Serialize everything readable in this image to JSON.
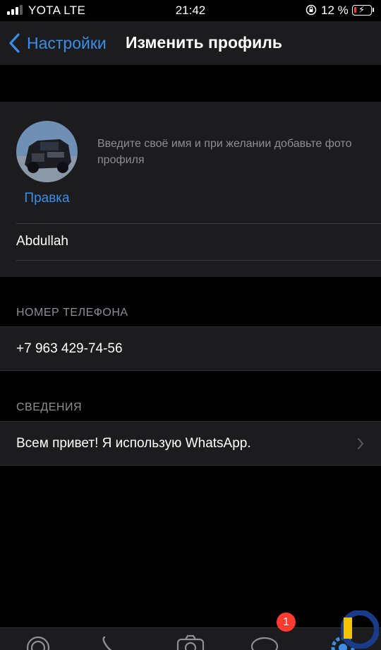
{
  "status_bar": {
    "carrier": "YOTA LTE",
    "time": "21:42",
    "battery_percent": "12 %",
    "battery_color": "#ff3b30"
  },
  "nav": {
    "back_label": "Настройки",
    "title": "Изменить профиль"
  },
  "profile": {
    "edit_photo_label": "Правка",
    "hint": "Введите своё имя и при желании добавьте фото профиля",
    "name": "Abdullah"
  },
  "phone_section": {
    "header": "НОМЕР ТЕЛЕФОНА",
    "value": "+7 963 429-74-56"
  },
  "about_section": {
    "header": "СВЕДЕНИЯ",
    "value": "Всем привет! Я использую WhatsApp."
  },
  "tabbar": {
    "tabs": [
      "status-icon",
      "calls-icon",
      "camera-icon",
      "chats-icon",
      "settings-icon"
    ],
    "chats_badge": "1",
    "accent": "#3a8ee6"
  }
}
